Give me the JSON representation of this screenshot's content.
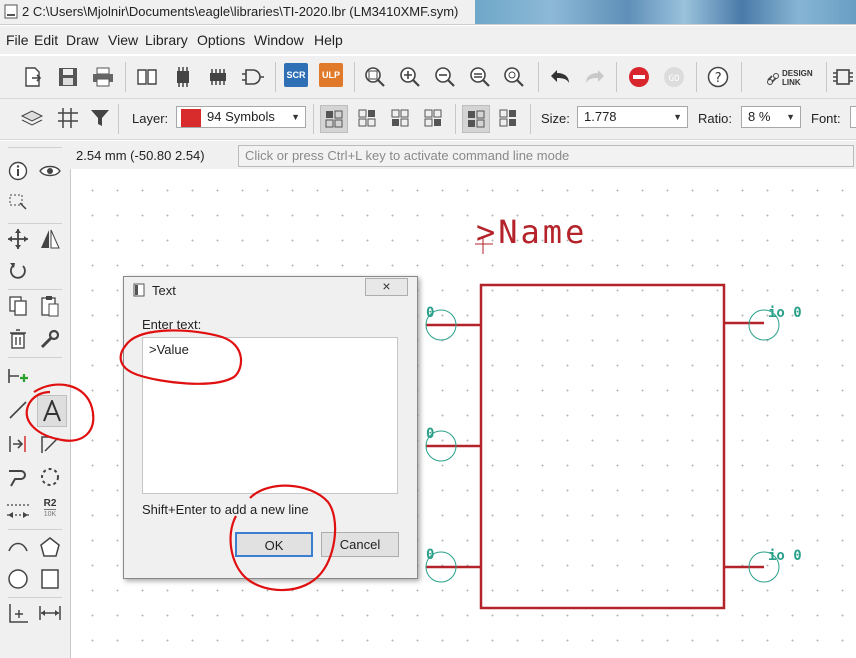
{
  "window": {
    "title": "2 C:\\Users\\Mjolnir\\Documents\\eagle\\libraries\\TI-2020.lbr (LM3410XMF.sym)"
  },
  "menu": [
    "File",
    "Edit",
    "Draw",
    "View",
    "Library",
    "Options",
    "Window",
    "Help"
  ],
  "toolbar": {
    "scr_label": "SCR",
    "ulp_label": "ULP",
    "design_link_label": "DESIGN\nLINK",
    "design_link_line1": "DESIGN",
    "design_link_line2": "LINK"
  },
  "param_bar": {
    "layer_label": "Layer:",
    "layer_value": "94 Symbols",
    "layer_color": "#d82c2c",
    "size_label": "Size:",
    "size_value": "1.778",
    "ratio_label": "Ratio:",
    "ratio_value": "8 %",
    "font_label": "Font:"
  },
  "status": {
    "coordinates": "2.54 mm (-50.80 2.54)",
    "command_placeholder": "Click or press Ctrl+L key to activate command line mode"
  },
  "left_toolbar": {
    "r2_label": "R2",
    "r2_sub": "10K"
  },
  "canvas": {
    "name_text": ">Name",
    "pin_labels_left": [
      "0",
      "0",
      "0"
    ],
    "pin_labels_right": [
      "io 0",
      "io 0"
    ],
    "symbol_color": "#b4232a",
    "pin_color": "#2aa08a"
  },
  "dialog": {
    "title": "Text",
    "close_label": "×",
    "prompt": "Enter text:",
    "text_value": ">Value",
    "hint": "Shift+Enter to add a new line",
    "ok_label": "OK",
    "cancel_label": "Cancel"
  }
}
